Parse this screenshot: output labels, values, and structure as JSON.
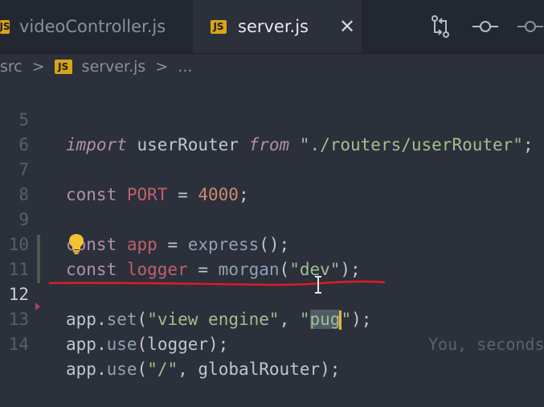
{
  "tabs": [
    {
      "label": "videoController.js",
      "badge": "JS",
      "active": false
    },
    {
      "label": "server.js",
      "badge": "JS",
      "active": true
    }
  ],
  "close_glyph": "✕",
  "actions": [
    "compare-changes-icon",
    "git-commit-icon",
    "git-commit-icon"
  ],
  "breadcrumb": {
    "folder": "src",
    "separator": ">",
    "file": "server.js",
    "more": "..."
  },
  "lines": [
    {
      "n": "5"
    },
    {
      "n": "6"
    },
    {
      "n": "7"
    },
    {
      "n": "8"
    },
    {
      "n": "9"
    },
    {
      "n": "10"
    },
    {
      "n": "11"
    },
    {
      "n": "12"
    },
    {
      "n": "13"
    },
    {
      "n": "14"
    }
  ],
  "code": {
    "l5": {
      "kw1": "import",
      "id": " userRouter ",
      "kw2": "from",
      "str": " \"./routers/userRouter\"",
      "end": ";"
    },
    "l7": {
      "kw": "const",
      "var": " PORT",
      "op": " = ",
      "num": "4000",
      "end": ";"
    },
    "l9": {
      "kw": "const",
      "var": " app",
      "op": " = ",
      "fn": "express",
      "end": "();"
    },
    "l10": {
      "kw": "const",
      "var": " logger",
      "op": " = ",
      "fn": "morgan",
      "open": "(",
      "str": "\"dev\"",
      "end": ");"
    },
    "l12": {
      "obj": "app",
      "dot": ".",
      "fn": "set",
      "open": "(",
      "str1": "\"view engine\"",
      "comma": ", ",
      "q1": "\"",
      "sel": "pug",
      "q2": "\"",
      "end": ");"
    },
    "l13": {
      "obj": "app",
      "dot": ".",
      "fn": "use",
      "rest": "(logger);"
    },
    "l14": {
      "obj": "app",
      "dot": ".",
      "fn": "use",
      "open": "(",
      "str": "\"/\"",
      "rest": ", globalRouter);"
    }
  },
  "blame": "You, seconds",
  "colors": {
    "background": "#2b303b",
    "tabbar": "#232730",
    "annotation": "#e01b24",
    "cursor": "#e8b23a"
  }
}
